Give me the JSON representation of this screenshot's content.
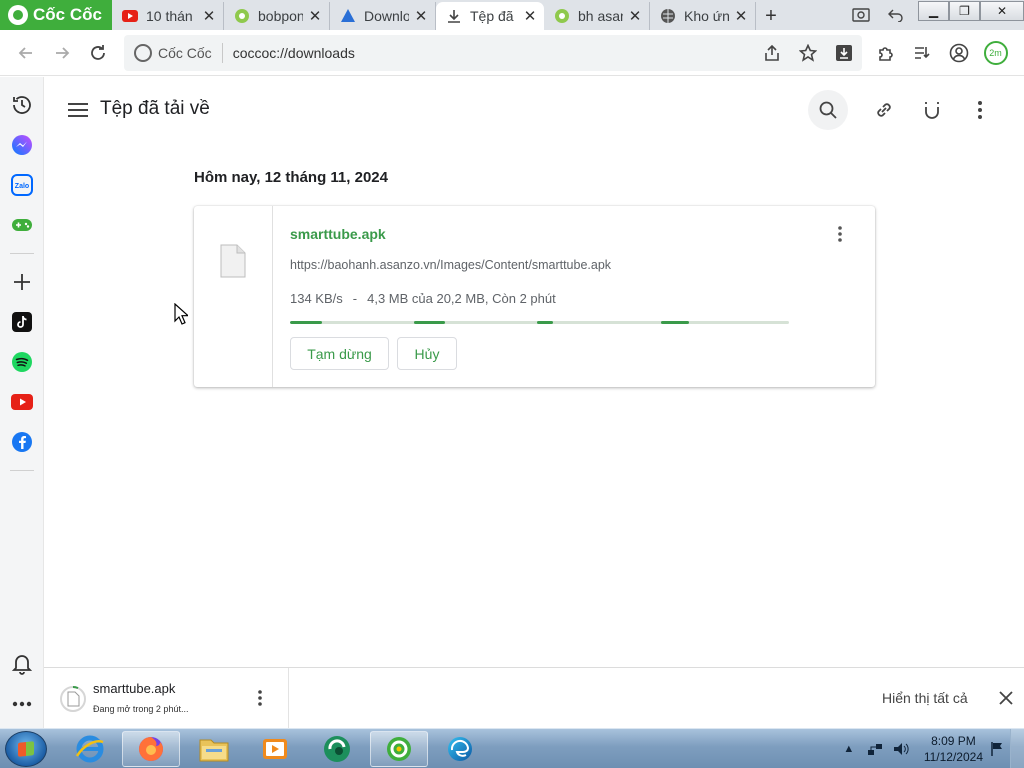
{
  "browser": {
    "brand": "Cốc Cốc",
    "tabs": [
      {
        "title": "10 thán",
        "icon": "youtube-icon"
      },
      {
        "title": "bobpon",
        "icon": "green-site-icon"
      },
      {
        "title": "Downlo",
        "icon": "blue-site-icon"
      },
      {
        "title": "Tệp đã",
        "icon": "download-icon",
        "active": true
      },
      {
        "title": "bh asan",
        "icon": "green-site-icon"
      },
      {
        "title": "Kho ứn",
        "icon": "globe-icon"
      }
    ],
    "omnibox": {
      "site_label": "Cốc Cốc",
      "url": "coccoc://downloads"
    },
    "profile_badge": "2m"
  },
  "page": {
    "title": "Tệp đã tải về",
    "date_heading": "Hôm nay, 12 tháng 11, 2024"
  },
  "download": {
    "file_name": "smarttube.apk",
    "url": "https://baohanh.asanzo.vn/Images/Content/smarttube.apk",
    "speed": "134 KB/s",
    "separator": "-",
    "status": "4,3 MB của 20,2 MB, Còn 2 phút",
    "pause_label": "Tạm dừng",
    "cancel_label": "Hủy"
  },
  "shelf": {
    "file_name": "smarttube.apk",
    "status": "Đang mở trong 2 phút...",
    "show_all": "Hiển thị tất cả"
  },
  "taskbar": {
    "time": "8:09 PM",
    "date": "11/12/2024",
    "apps": [
      "internet-explorer",
      "firefox",
      "file-explorer",
      "media-player",
      "greenshot",
      "coccoc",
      "edge"
    ]
  },
  "colors": {
    "accent_green": "#3a9a4a",
    "brand_green": "#3fae3c"
  }
}
